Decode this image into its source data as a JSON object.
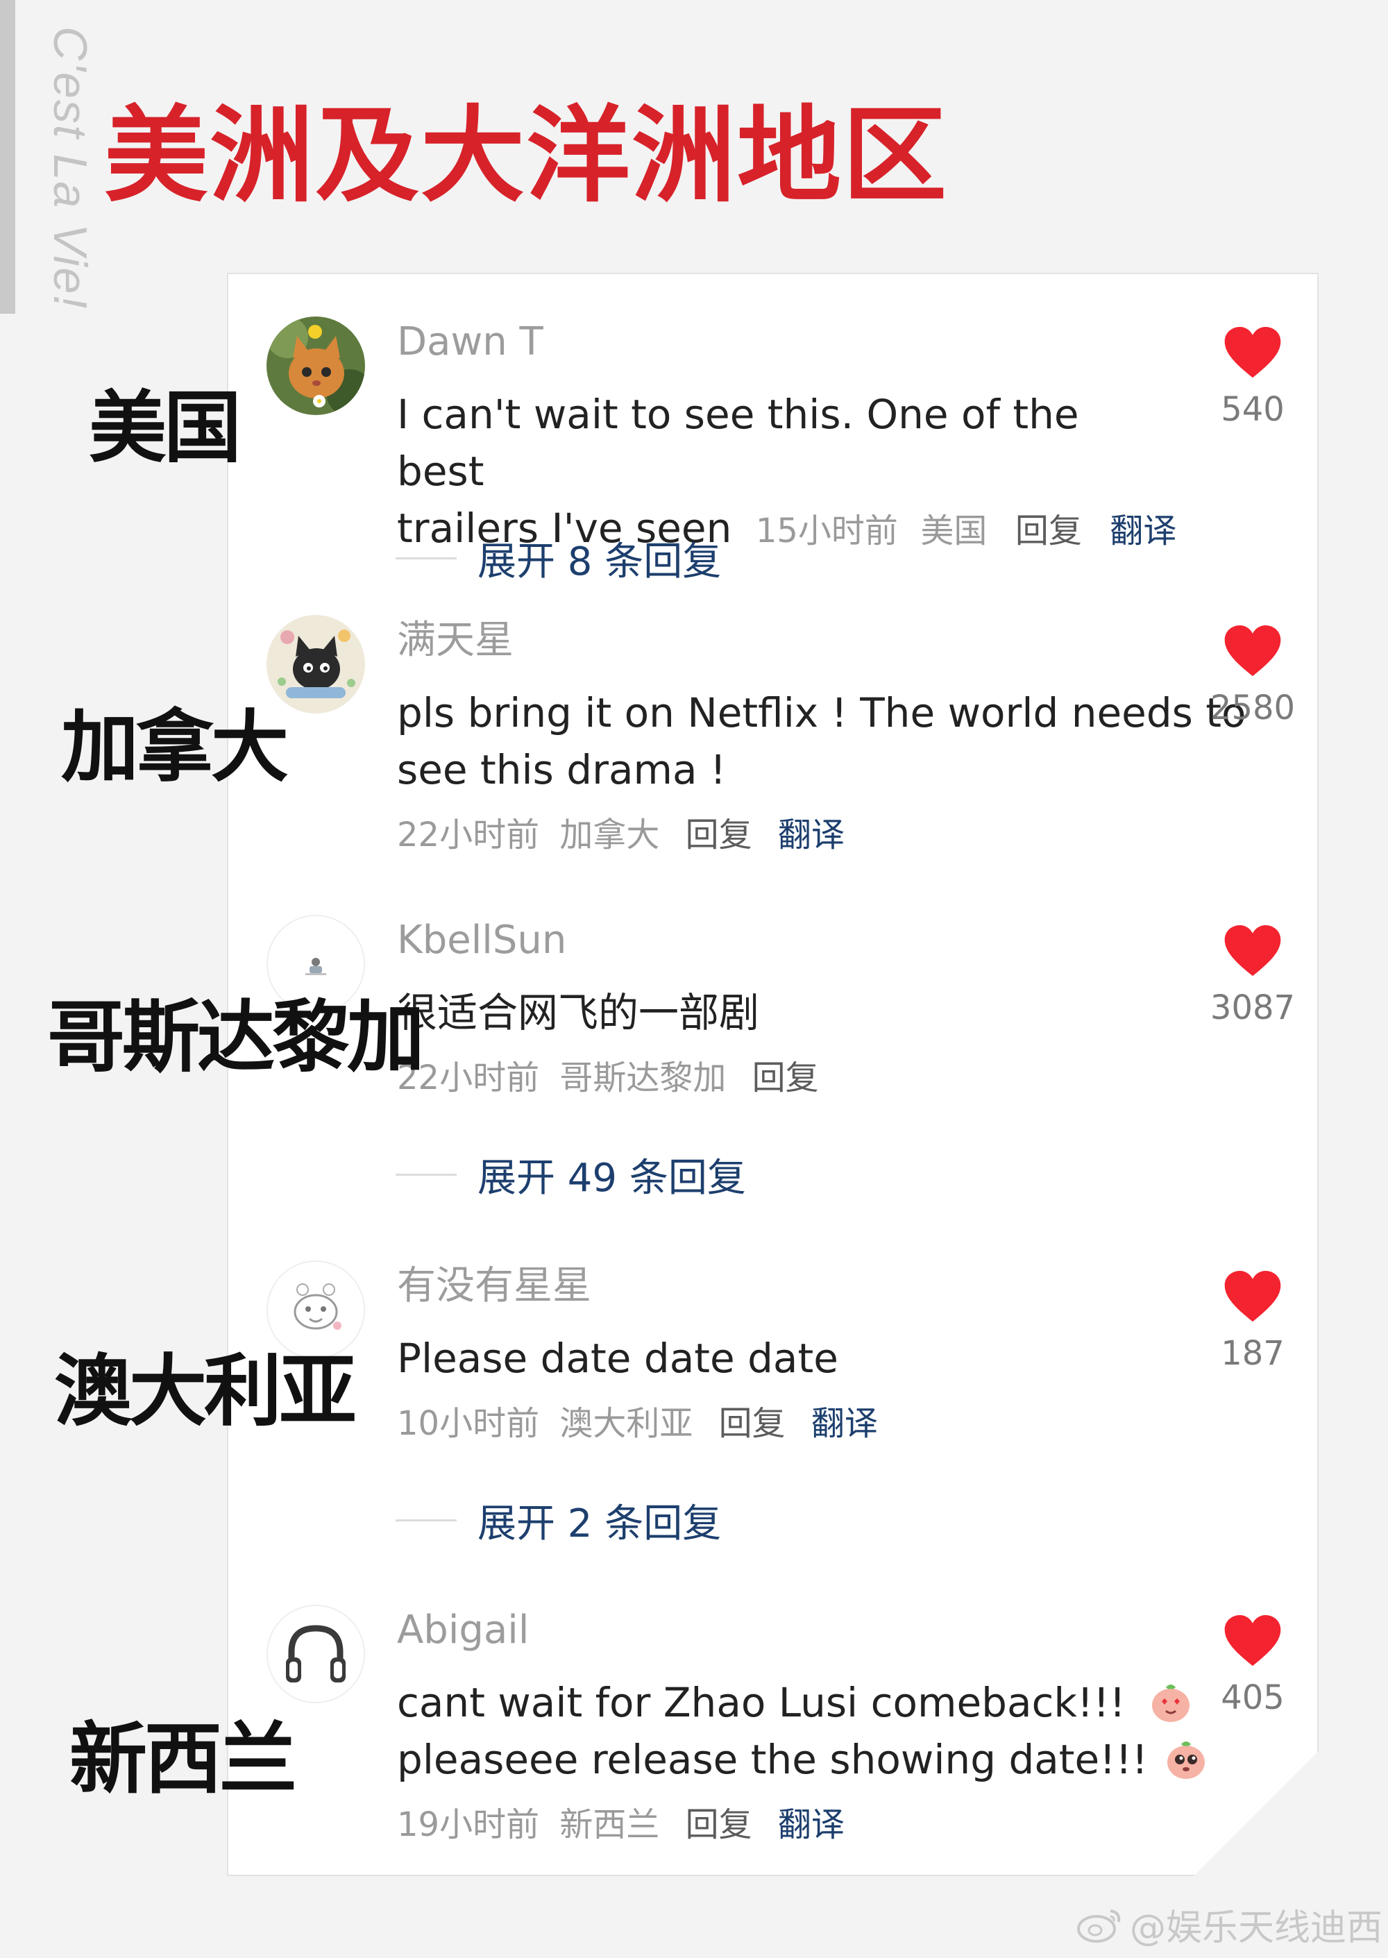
{
  "side_caption": "C'est La Vie!",
  "page_title": "美洲及大洋洲地区",
  "regions": [
    "美国",
    "加拿大",
    "哥斯达黎加",
    "澳大利亚",
    "新西兰"
  ],
  "colors": {
    "title": "#d7222a",
    "heart": "#f3232f",
    "link": "#1d3f6e",
    "username": "#9c9c9c",
    "meta": "#9a9a9a"
  },
  "comments": [
    {
      "avatar_icon": "kitten-flower-icon",
      "username": "Dawn T",
      "text_line1": "I can't wait to see this. One of the best",
      "text_line2": "trailers I've seen",
      "time": "15小时前",
      "location": "美国",
      "reply_label": "回复",
      "translate_label": "翻译",
      "likes": "540",
      "expand_label": "展开 8 条回复"
    },
    {
      "avatar_icon": "cartoon-cat-icon",
      "username": "满天星",
      "text_line1": "pls bring it on Netflix ! The world needs to",
      "text_line2": "see this drama !",
      "time": "22小时前",
      "location": "加拿大",
      "reply_label": "回复",
      "translate_label": "翻译",
      "likes": "2580"
    },
    {
      "avatar_icon": "small-figure-icon",
      "username": "KbellSun",
      "text_line1": "很适合网飞的一部剧",
      "time": "22小时前",
      "location": "哥斯达黎加",
      "reply_label": "回复",
      "likes": "3087",
      "expand_label": "展开 49 条回复"
    },
    {
      "avatar_icon": "sketch-animal-icon",
      "username": "有没有星星",
      "text_line1": "Please date date date",
      "time": "10小时前",
      "location": "澳大利亚",
      "reply_label": "回复",
      "translate_label": "翻译",
      "likes": "187",
      "expand_label": "展开 2 条回复"
    },
    {
      "avatar_icon": "headphones-icon",
      "username": "Abigail",
      "text_line1": "cant wait for Zhao Lusi comeback!!!",
      "text_line2": "pleaseee release the showing date!!!",
      "time": "19小时前",
      "location": "新西兰",
      "reply_label": "回复",
      "translate_label": "翻译",
      "likes": "405"
    }
  ],
  "watermark": "@娱乐天线迪西"
}
